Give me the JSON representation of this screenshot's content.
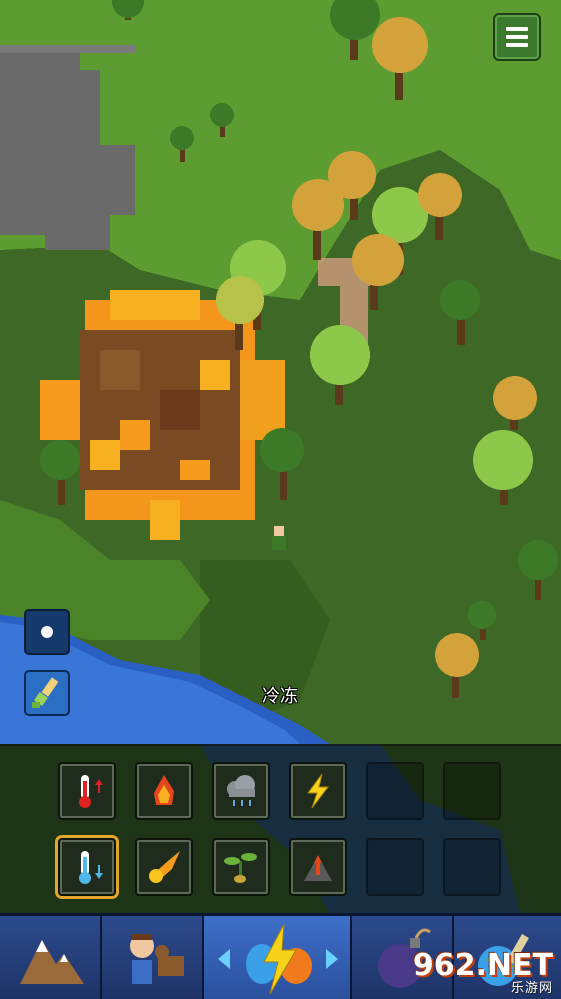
{
  "hud": {
    "menu_icon": "hamburger-menu-icon",
    "brush_size_icon": "brush-size-dot-icon",
    "paint_icon": "paintbrush-icon"
  },
  "tool_label": "冷冻",
  "powers_row1": [
    {
      "name": "heat",
      "icon": "thermometer-up-icon",
      "empty": false
    },
    {
      "name": "fire",
      "icon": "fire-icon",
      "empty": false
    },
    {
      "name": "rain-cloud",
      "icon": "rain-cloud-icon",
      "empty": false
    },
    {
      "name": "lightning",
      "icon": "lightning-icon",
      "empty": false
    },
    {
      "name": "empty",
      "icon": "",
      "empty": true
    },
    {
      "name": "empty",
      "icon": "",
      "empty": true
    }
  ],
  "powers_row2": [
    {
      "name": "freeze",
      "icon": "thermometer-down-icon",
      "empty": false,
      "selected": true
    },
    {
      "name": "fireball",
      "icon": "fireball-icon",
      "empty": false
    },
    {
      "name": "seed",
      "icon": "sprout-icon",
      "empty": false
    },
    {
      "name": "volcano",
      "icon": "volcano-icon",
      "empty": false
    },
    {
      "name": "empty",
      "icon": "",
      "empty": true
    },
    {
      "name": "empty",
      "icon": "",
      "empty": true
    }
  ],
  "tabs": [
    {
      "name": "terrain",
      "icon": "mountain-icon"
    },
    {
      "name": "creatures",
      "icon": "villager-and-cow-icon"
    },
    {
      "name": "powers",
      "icon": "lightning-water-fire-icon",
      "active": true
    },
    {
      "name": "bombs",
      "icon": "bomb-icon"
    },
    {
      "name": "tools",
      "icon": "globe-tools-icon"
    }
  ],
  "watermark": {
    "main": "962.NET",
    "sub": "乐游网"
  },
  "colors": {
    "grass_light": "#5a9a2f",
    "grass_dark": "#385c1f",
    "water": "#2a60c4",
    "fire": "#f59a1c",
    "accent_selected": "#e1a62a"
  }
}
